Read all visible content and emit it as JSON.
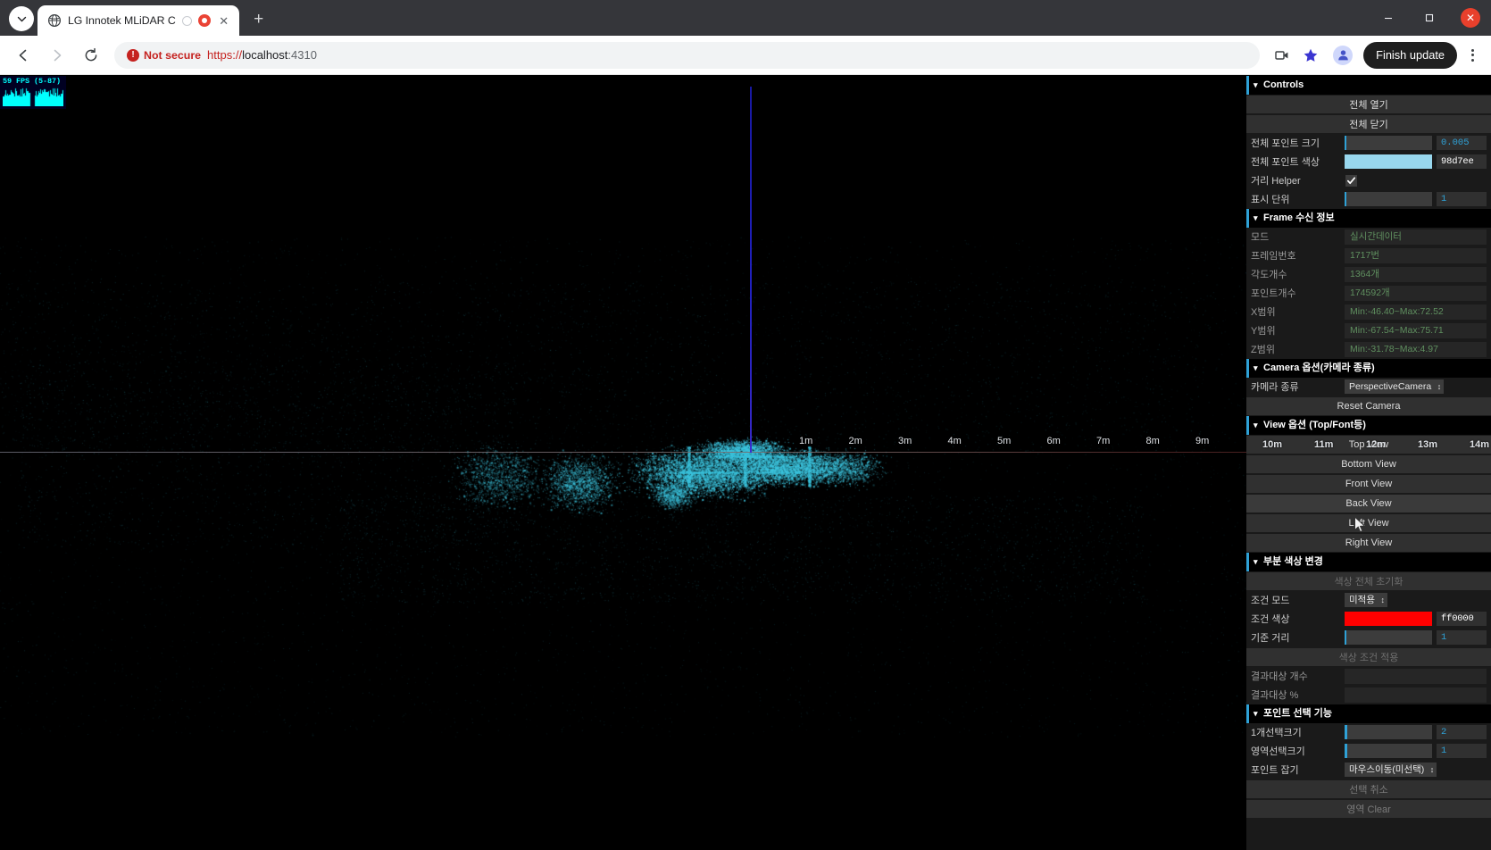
{
  "browser": {
    "tab": {
      "title": "LG Innotek MLiDAR C",
      "favicon_icon": "globe-icon",
      "loading_icon": "spinner-icon",
      "recording_icon": "record-dot-icon",
      "close_icon": "close-icon"
    },
    "new_tab_label": "+",
    "tabstrip_menu_icon": "chevron-down-icon",
    "window": {
      "minimize_icon": "minimize-icon",
      "maximize_icon": "maximize-icon",
      "close_icon": "window-close-icon"
    },
    "toolbar": {
      "back_icon": "arrow-left-icon",
      "forward_icon": "arrow-right-icon",
      "reload_icon": "reload-icon",
      "security_label": "Not secure",
      "security_icon": "not-secure-icon",
      "url_scheme": "https://",
      "url_host": "localhost",
      "url_port": ":4310",
      "cast_icon": "screen-cast-icon",
      "bookmark_icon": "star-icon",
      "profile_icon": "profile-avatar-icon",
      "finish_update_label": "Finish update",
      "menu_icon": "kebab-menu-icon"
    }
  },
  "viewport": {
    "stats": {
      "label": "59 FPS (5-87)",
      "graph_icon": "fps-graph-icon"
    },
    "axis": {
      "horizontal_icon": "horizontal-axis-line",
      "vertical_icon": "vertical-axis-line"
    },
    "distance_labels": [
      "1m",
      "2m",
      "3m",
      "4m",
      "5m",
      "6m",
      "7m",
      "8m",
      "9m"
    ],
    "distance_labels_behind_panel": [
      "10m",
      "11m",
      "12m",
      "13m",
      "14m"
    ],
    "point_color": "#3ec6e0",
    "background": "#000000",
    "cursor_icon": "mouse-pointer-icon"
  },
  "gui": {
    "controls": {
      "title": "Controls",
      "caret_icon": "chevron-down-icon",
      "open_all_label": "전체 열기",
      "close_all_label": "전체 닫기",
      "point_size": {
        "label": "전체 포인트 크기",
        "value": "0.005",
        "fill_pct": 2
      },
      "point_color": {
        "label": "전체 포인트 색상",
        "value": "98d7ee",
        "color": "#98d7ee"
      },
      "distance_helper": {
        "label": "거리 Helper",
        "checked": true,
        "check_icon": "checkmark-icon"
      },
      "display_unit": {
        "label": "표시 단위",
        "value": "1",
        "fill_pct": 2
      }
    },
    "frame_info": {
      "title": "Frame 수신 정보",
      "caret_icon": "chevron-down-icon",
      "rows": [
        {
          "label": "모드",
          "value": "실시간데이터"
        },
        {
          "label": "프레임번호",
          "value": "1717번"
        },
        {
          "label": "각도개수",
          "value": "1364개"
        },
        {
          "label": "포인트개수",
          "value": "174592개"
        },
        {
          "label": "X범위",
          "value": "Min:-46.40~Max:72.52"
        },
        {
          "label": "Y범위",
          "value": "Min:-67.54~Max:75.71"
        },
        {
          "label": "Z범위",
          "value": "Min:-31.78~Max:4.97"
        }
      ]
    },
    "camera": {
      "title": "Camera 옵션(카메라 종류)",
      "caret_icon": "chevron-down-icon",
      "type_label": "카메라 종류",
      "type_value": "PerspectiveCamera",
      "reset_label": "Reset Camera"
    },
    "view": {
      "title": "View 옵션 (Top/Font등)",
      "caret_icon": "chevron-down-icon",
      "buttons": [
        "Top View",
        "Bottom View",
        "Front View",
        "Back View",
        "Left View",
        "Right View"
      ],
      "hovered": "Back View"
    },
    "partial_color": {
      "title": "부분 색상 변경",
      "caret_icon": "chevron-down-icon",
      "reset_all_label": "색상 전체 초기화",
      "condition_mode": {
        "label": "조건 모드",
        "value": "미적용"
      },
      "condition_color": {
        "label": "조건 색상",
        "value": "ff0000",
        "color": "#ff0000"
      },
      "base_distance": {
        "label": "기준 거리",
        "value": "1",
        "fill_pct": 2
      },
      "apply_label": "색상 조건 적용",
      "result_count": {
        "label": "결과대상 개수",
        "value": ""
      },
      "result_pct": {
        "label": "결과대상 %",
        "value": ""
      }
    },
    "point_select": {
      "title": "포인트 선택 기능",
      "caret_icon": "chevron-down-icon",
      "single_size": {
        "label": "1개선택크기",
        "value": "2",
        "fill_pct": 3
      },
      "area_size": {
        "label": "영역선택크기",
        "value": "1",
        "fill_pct": 3
      },
      "grab_mode": {
        "label": "포인트 잡기",
        "value": "마우스이동(미선택)"
      },
      "cancel_label": "선택 취소",
      "clear_label": "영역 Clear"
    }
  }
}
